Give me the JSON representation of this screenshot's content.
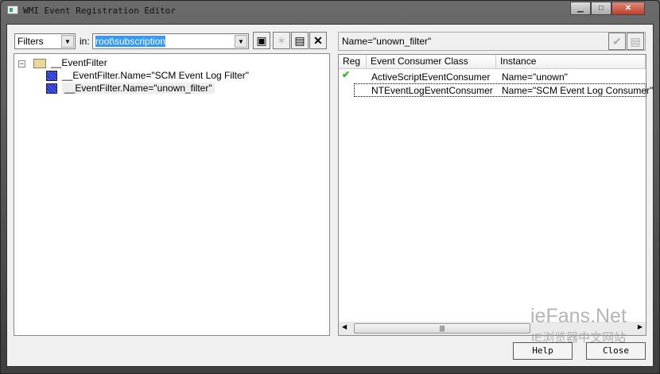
{
  "window": {
    "title": "WMI Event Registration Editor"
  },
  "left": {
    "type_select": "Filters",
    "in_label": "in:",
    "namespace": "root\\subscription",
    "tree": {
      "root": "__EventFilter",
      "children": [
        "__EventFilter.Name=\"SCM Event Log Filter\"",
        "__EventFilter.Name=\"unown_filter\""
      ]
    }
  },
  "right": {
    "selected_name": "Name=\"unown_filter\"",
    "columns": [
      "Reg",
      "Event Consumer Class",
      "Instance"
    ],
    "rows": [
      {
        "registered": true,
        "class": "ActiveScriptEventConsumer",
        "instance": "Name=\"unown\""
      },
      {
        "registered": false,
        "class": "NTEventLogEventConsumer",
        "instance": "Name=\"SCM Event Log Consumer\""
      }
    ]
  },
  "buttons": {
    "help": "Help",
    "close": "Close"
  },
  "watermark": {
    "line1": "ieFans.Net",
    "line2": "IE浏览器中文网站"
  },
  "colors": {
    "selection": "#3399ff",
    "check": "#22bb22"
  }
}
